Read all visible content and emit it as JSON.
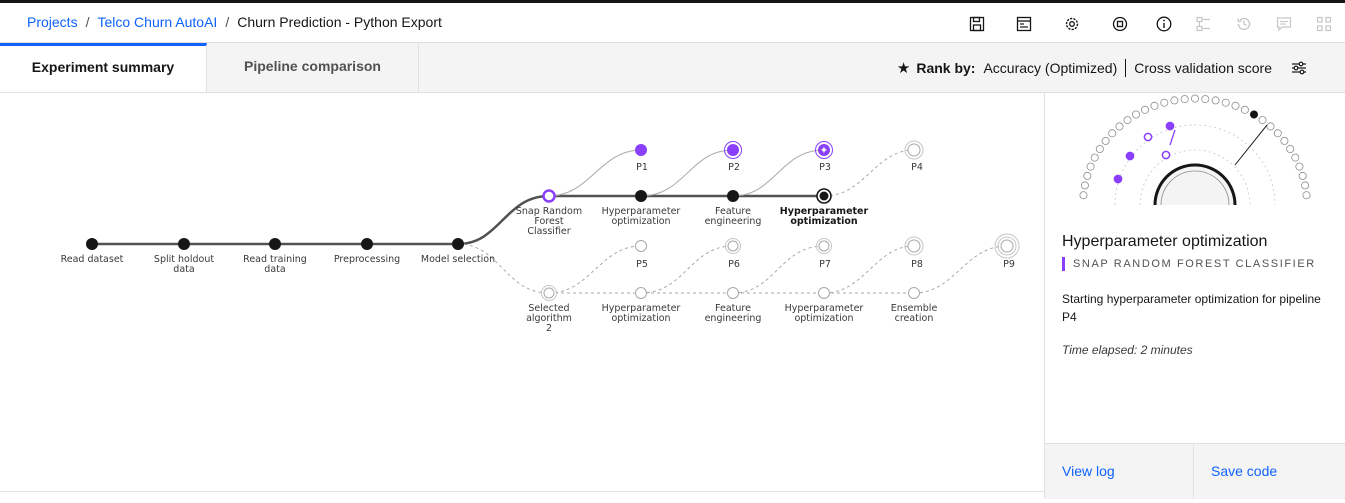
{
  "breadcrumb": {
    "items": [
      "Projects",
      "Telco Churn AutoAI"
    ],
    "separator": "/",
    "current": "Churn Prediction - Python Export"
  },
  "header_icons": [
    "save-icon",
    "notebook-icon",
    "settings-icon",
    "deploy-icon",
    "info-icon",
    "flow-icon",
    "history-icon",
    "comment-icon",
    "apps-icon"
  ],
  "tabs": [
    {
      "label": "Experiment summary",
      "active": true
    },
    {
      "label": "Pipeline comparison",
      "active": false
    }
  ],
  "rank": {
    "label": "Rank by:",
    "metric": "Accuracy (Optimized)",
    "score": "Cross validation score"
  },
  "pipeline": {
    "main_stages": [
      "Read dataset",
      "Split holdout data",
      "Read training data",
      "Preprocessing",
      "Model selection"
    ],
    "upper_algorithm": "Snap Random Forest Classifier",
    "upper_stages": [
      "Hyperparameter optimization",
      "Feature engineering",
      "Hyperparameter optimization"
    ],
    "upper_pipelines": [
      "P1",
      "P2",
      "P3",
      "P4"
    ],
    "lower_algorithm": "Selected algorithm 2",
    "lower_stages": [
      "Hyperparameter optimization",
      "Feature engineering",
      "Hyperparameter optimization",
      "Ensemble creation"
    ],
    "lower_pipelines": [
      "P5",
      "P6",
      "P7",
      "P8",
      "P9"
    ]
  },
  "panel": {
    "title": "Hyperparameter optimization",
    "subtitle": "SNAP RANDOM FOREST CLASSIFIER",
    "description": "Starting hyperparameter optimization for pipeline P4",
    "elapsed": "Time elapsed: 2 minutes",
    "view_log": "View log",
    "save_code": "Save code"
  },
  "colors": {
    "accent": "#0f62fe",
    "purple": "#8a3ffc",
    "dark": "#161616"
  }
}
